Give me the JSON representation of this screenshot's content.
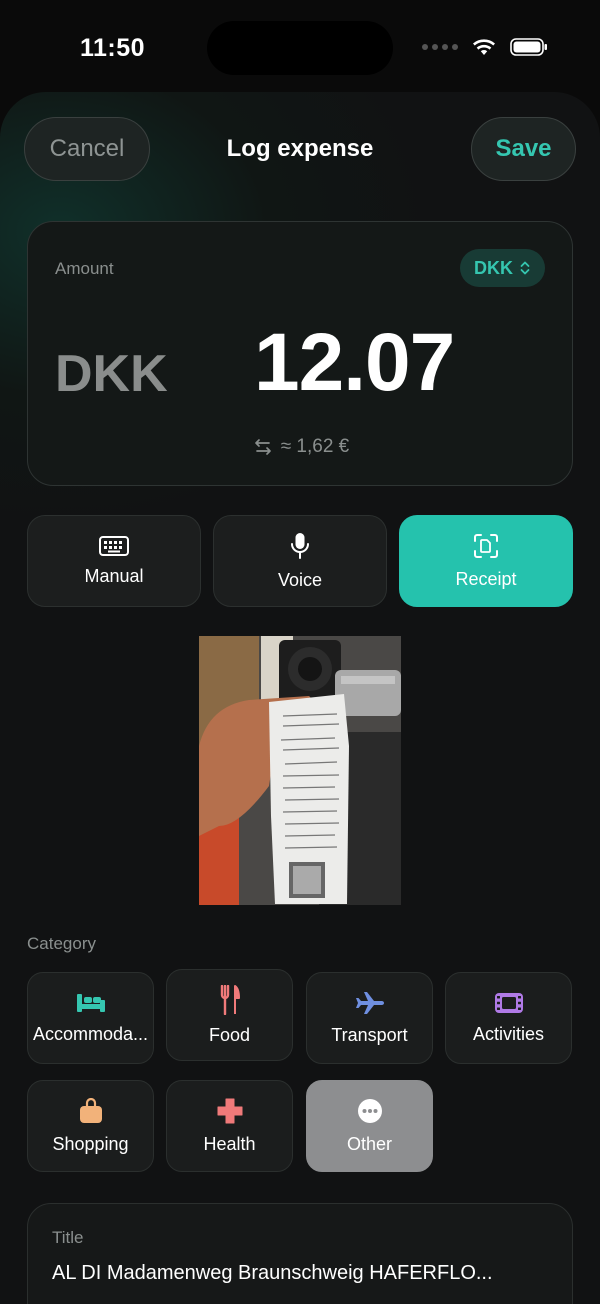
{
  "status": {
    "time": "11:50"
  },
  "nav": {
    "cancel_label": "Cancel",
    "title": "Log expense",
    "save_label": "Save"
  },
  "amount": {
    "label": "Amount",
    "currency_picker": "DKK",
    "currency_code": "DKK",
    "value": "12.07",
    "conversion": "≈ 1,62 €"
  },
  "modes": [
    {
      "label": "Manual",
      "icon": "keyboard-icon"
    },
    {
      "label": "Voice",
      "icon": "microphone-icon"
    },
    {
      "label": "Receipt",
      "icon": "receipt-scan-icon",
      "selected": true
    }
  ],
  "category": {
    "label": "Category",
    "items": [
      {
        "label": "Accommoda...",
        "icon": "bed-icon",
        "color": "#35c6b0"
      },
      {
        "label": "Food",
        "icon": "fork-knife-icon",
        "color": "#f07a7a"
      },
      {
        "label": "Transport",
        "icon": "airplane-icon",
        "color": "#6f8fe0"
      },
      {
        "label": "Activities",
        "icon": "film-ticket-icon",
        "color": "#b07ae6"
      },
      {
        "label": "Shopping",
        "icon": "shopping-bag-icon",
        "color": "#f2b27a"
      },
      {
        "label": "Health",
        "icon": "medical-cross-icon",
        "color": "#f07a7a"
      },
      {
        "label": "Other",
        "icon": "more-icon",
        "color": "#ffffff",
        "selected": true
      }
    ]
  },
  "title_field": {
    "label": "Title",
    "value": "AL DI Madamenweg Braunschweig HAFERFLO..."
  },
  "colors": {
    "accent": "#25c2ad",
    "accent_text": "#35c6b0"
  }
}
